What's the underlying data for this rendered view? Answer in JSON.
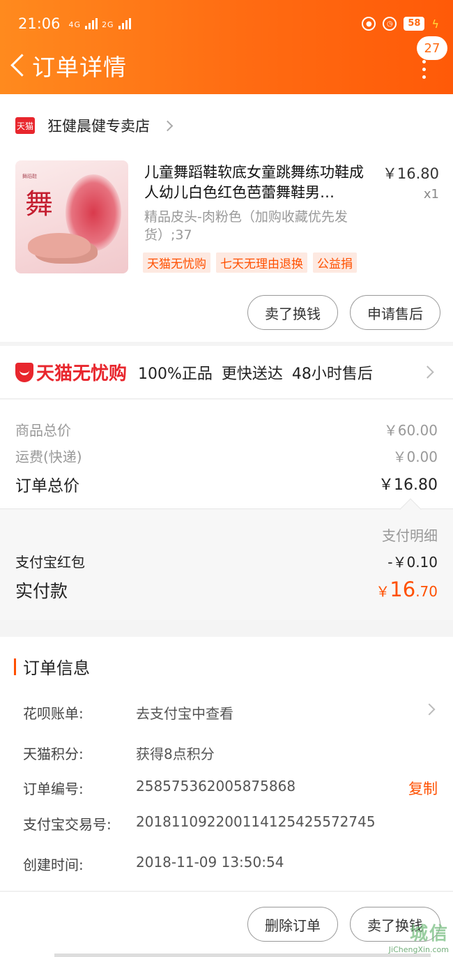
{
  "status": {
    "time": "21:06",
    "sig1": "4G",
    "sig2": "2G",
    "battery": "58"
  },
  "header": {
    "title": "订单详情",
    "badge": "27"
  },
  "shop": {
    "logo": "天猫",
    "name": "狂健晨健专卖店"
  },
  "product": {
    "name": "儿童舞蹈鞋软底女童跳舞练功鞋成人幼儿白色红色芭蕾舞鞋男…",
    "price": "￥16.80",
    "qty": "x1",
    "sku": "精品皮头-肉粉色（加购收藏优先发货）;37",
    "tags": [
      "天猫无忧购",
      "七天无理由退换",
      "公益捐"
    ],
    "thumb_glyph": "舞",
    "thumb_small": "舞蹈鞋"
  },
  "actions": {
    "sell": "卖了换钱",
    "after_sale": "申请售后"
  },
  "banner": {
    "brand": "天猫无忧购",
    "features": "100%正品  更快送达  48小时售后"
  },
  "summary": {
    "goods_label": "商品总价",
    "goods_value": "￥60.00",
    "shipping_label": "运费(快递)",
    "shipping_value": "￥0.00",
    "total_label": "订单总价",
    "total_value": "￥16.80",
    "pay_detail": "支付明细",
    "redpack_label": "支付宝红包",
    "redpack_value": "-￥0.10",
    "paid_label": "实付款",
    "paid_symbol": "￥",
    "paid_int": "16",
    "paid_dec": ".70"
  },
  "info": {
    "title": "订单信息",
    "huabei_label": "花呗账单:",
    "huabei_value": "去支付宝中查看",
    "points_label": "天猫积分:",
    "points_value": "获得8点积分",
    "order_no_label": "订单编号:",
    "order_no_value": "258575362005875868",
    "copy": "复制",
    "trade_no_label": "支付宝交易号:",
    "trade_no_value": "2018110922001141254255727 45",
    "created_label": "创建时间:",
    "created_value": "2018-11-09 13:50:54"
  },
  "footer": {
    "delete": "删除订单",
    "sell": "卖了换钱"
  },
  "watermark": {
    "main": "城信",
    "sub": "JiChengXin.com"
  }
}
